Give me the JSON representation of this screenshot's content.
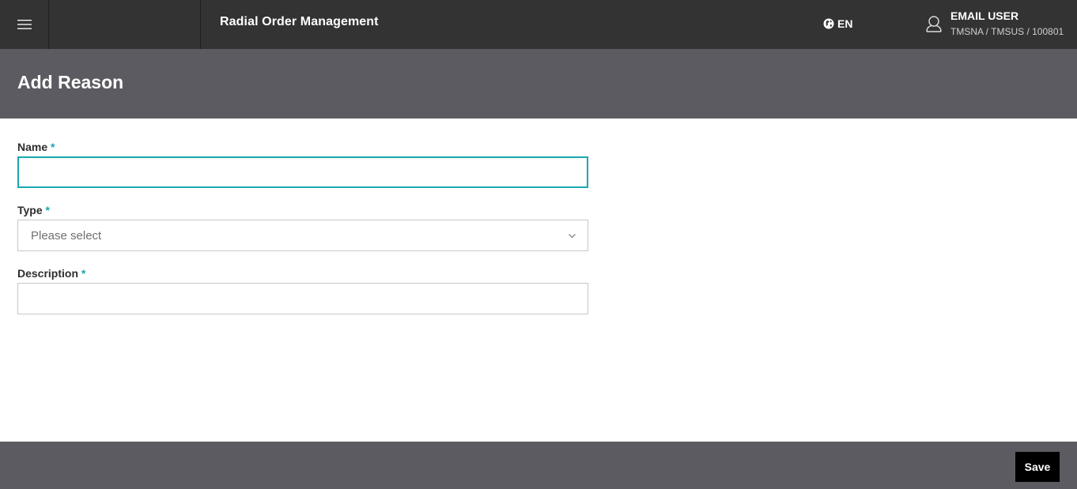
{
  "topbar": {
    "app_title": "Radial Order Management",
    "language": "EN",
    "user_name": "EMAIL USER",
    "user_org": "TMSNA / TMSUS / 100801"
  },
  "page": {
    "title": "Add Reason"
  },
  "form": {
    "name": {
      "label": "Name",
      "required_mark": "*",
      "value": ""
    },
    "type": {
      "label": "Type",
      "required_mark": "*",
      "selected": "Please select"
    },
    "description": {
      "label": "Description",
      "required_mark": "*",
      "value": ""
    }
  },
  "footer": {
    "save_label": "Save"
  },
  "colors": {
    "topbar": "#333333",
    "band": "#5c5b61",
    "accent": "#1aa7b0",
    "button": "#000000"
  }
}
